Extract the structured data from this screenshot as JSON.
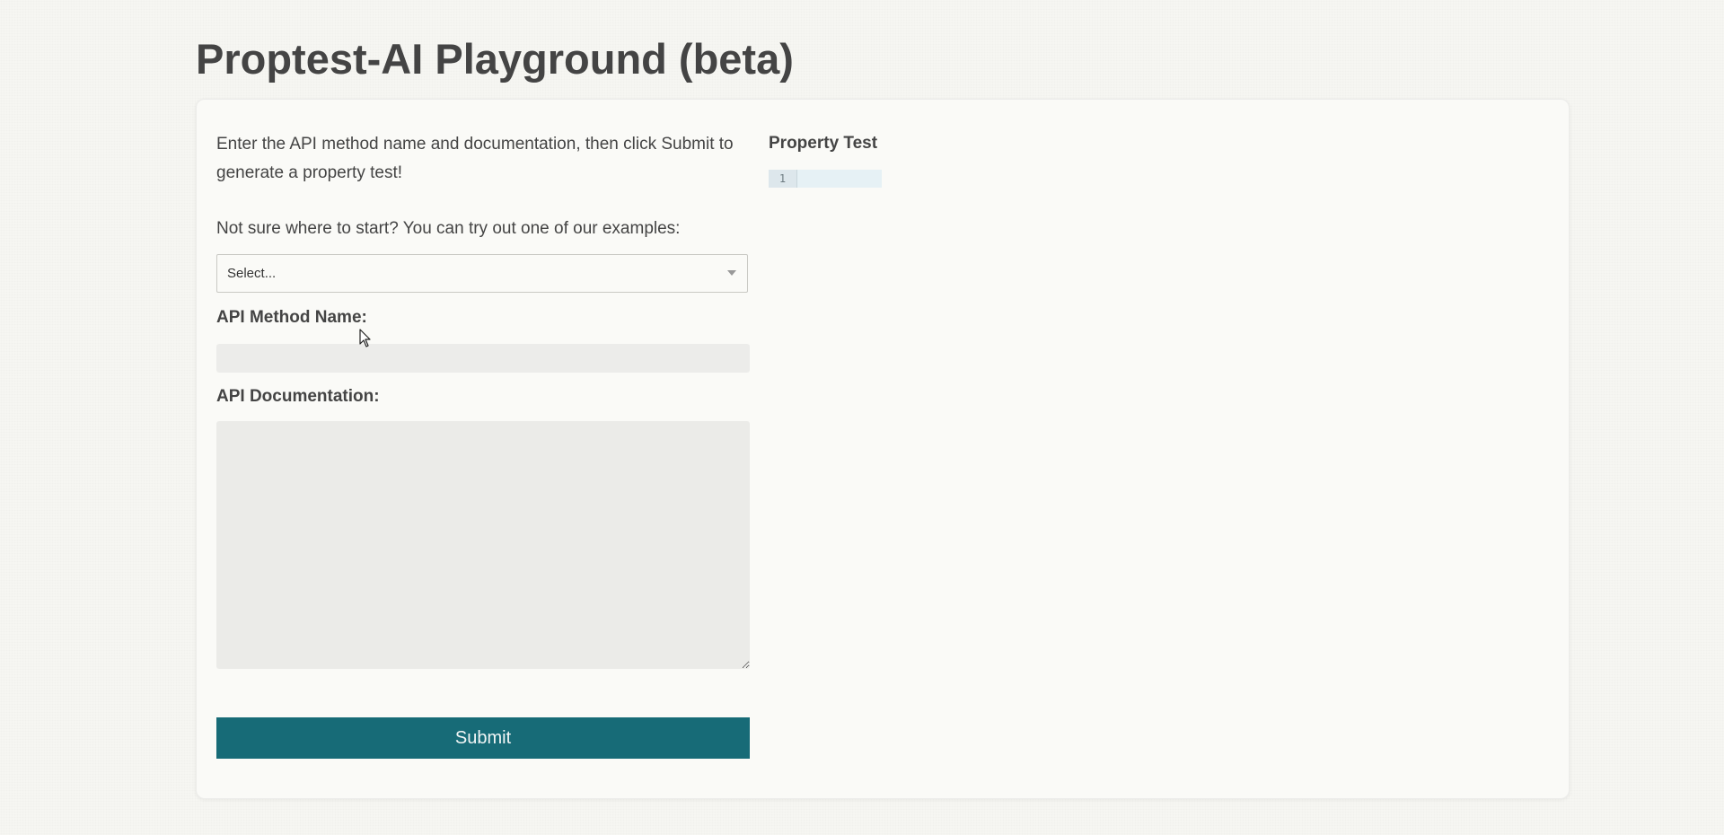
{
  "header": {
    "title": "Proptest-AI Playground (beta)"
  },
  "form": {
    "intro": "Enter the API method name and documentation, then click Submit to generate a property test!",
    "examples_prompt": "Not sure where to start? You can try out one of our examples:",
    "example_select": {
      "placeholder": "Select..."
    },
    "method_name": {
      "label": "API Method Name:",
      "value": ""
    },
    "documentation": {
      "label": "API Documentation:",
      "value": ""
    },
    "submit_label": "Submit"
  },
  "output": {
    "label": "Property Test",
    "editor": {
      "line_numbers": [
        "1"
      ],
      "lines": [
        ""
      ]
    }
  },
  "colors": {
    "accent": "#176b77",
    "text": "#444444",
    "background": "#f6f6f2"
  }
}
